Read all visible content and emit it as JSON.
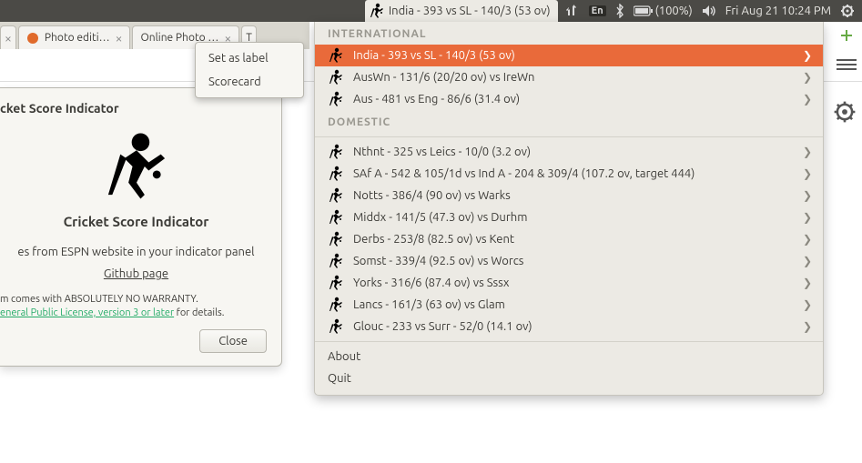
{
  "menubar": {
    "indicator_label": "India - 393 vs SL - 140/3 (53 ov)",
    "lang": "En",
    "battery": "(100%)",
    "clock": "Fri Aug 21 10:24 PM"
  },
  "tabs": [
    {
      "title": "",
      "showClose": true
    },
    {
      "title": "Photo editi…",
      "showClose": true
    },
    {
      "title": "Online Photo …",
      "showClose": true
    },
    {
      "title": "T",
      "showClose": false
    }
  ],
  "context_menu": {
    "items": [
      "Set as label",
      "Scorecard"
    ]
  },
  "about": {
    "window_title": "cket Score Indicator",
    "app_name": "Cricket Score Indicator",
    "description": "es from ESPN website in your indicator panel",
    "link": "Github page",
    "warranty_line1": "m comes with ABSOLUTELY NO WARRANTY.",
    "warranty_line2_prefix": "eneral Public License, version 3 or later",
    "warranty_line2_suffix": " for details.",
    "close": "Close"
  },
  "dropdown": {
    "section_intl": "INTERNATIONAL",
    "intl": [
      {
        "label": "India - 393 vs SL - 140/3 (53 ov)",
        "selected": true
      },
      {
        "label": "AusWn - 131/6 (20/20 ov) vs IreWn",
        "selected": false
      },
      {
        "label": "Aus - 481 vs Eng - 86/6 (31.4 ov)",
        "selected": false
      }
    ],
    "section_dom": "DOMESTIC",
    "dom": [
      {
        "label": "Nthnt - 325 vs Leics - 10/0 (3.2 ov)"
      },
      {
        "label": "SAf A - 542 & 105/1d vs Ind A - 204 & 309/4 (107.2 ov, target 444)"
      },
      {
        "label": "Notts - 386/4 (90 ov) vs Warks"
      },
      {
        "label": "Middx - 141/5 (47.3 ov) vs Durhm"
      },
      {
        "label": "Derbs - 253/8 (82.5 ov) vs Kent"
      },
      {
        "label": "Somst - 339/4 (92.5 ov) vs Worcs"
      },
      {
        "label": "Yorks - 316/6 (87.4 ov) vs Sssx"
      },
      {
        "label": "Lancs - 161/3 (63 ov) vs Glam"
      },
      {
        "label": "Glouc - 233 vs Surr - 52/0 (14.1 ov)"
      }
    ],
    "about": "About",
    "quit": "Quit"
  }
}
